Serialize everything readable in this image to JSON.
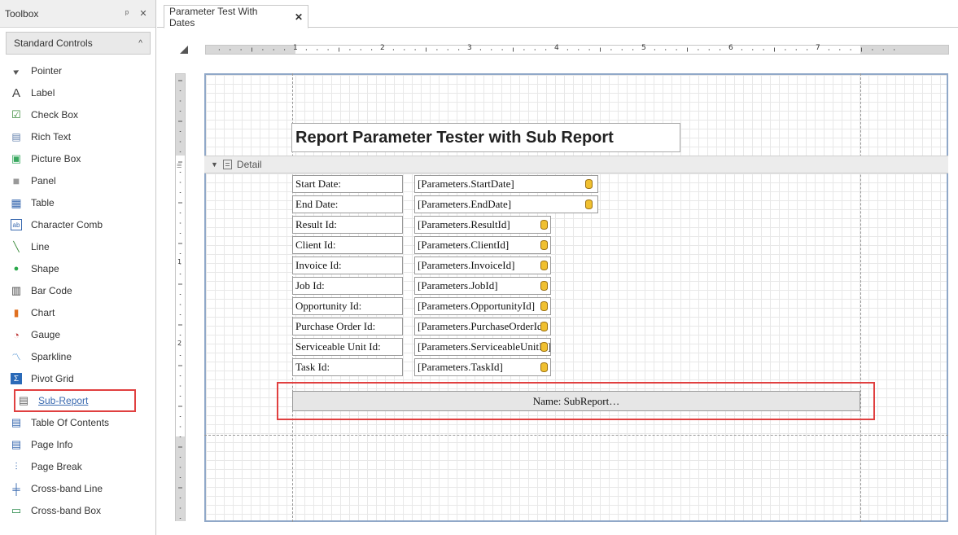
{
  "toolbox": {
    "title": "Toolbox",
    "pin_glyph": "ᵖ",
    "close_glyph": "✕",
    "group": {
      "title": "Standard Controls",
      "chevron": "^"
    },
    "items": [
      {
        "label": "Pointer",
        "icon": "pointer-icon"
      },
      {
        "label": "Label",
        "icon": "label-icon"
      },
      {
        "label": "Check Box",
        "icon": "check-box-icon"
      },
      {
        "label": "Rich Text",
        "icon": "rich-text-icon"
      },
      {
        "label": "Picture Box",
        "icon": "picture-box-icon"
      },
      {
        "label": "Panel",
        "icon": "panel-icon"
      },
      {
        "label": "Table",
        "icon": "table-icon"
      },
      {
        "label": "Character Comb",
        "icon": "character-comb-icon"
      },
      {
        "label": "Line",
        "icon": "line-icon"
      },
      {
        "label": "Shape",
        "icon": "shape-icon"
      },
      {
        "label": "Bar Code",
        "icon": "bar-code-icon"
      },
      {
        "label": "Chart",
        "icon": "chart-icon"
      },
      {
        "label": "Gauge",
        "icon": "gauge-icon"
      },
      {
        "label": "Sparkline",
        "icon": "sparkline-icon"
      },
      {
        "label": "Pivot Grid",
        "icon": "pivot-grid-icon"
      },
      {
        "label": "Sub-Report",
        "icon": "sub-report-icon"
      },
      {
        "label": "Table Of Contents",
        "icon": "table-of-contents-icon"
      },
      {
        "label": "Page Info",
        "icon": "page-info-icon"
      },
      {
        "label": "Page Break",
        "icon": "page-break-icon"
      },
      {
        "label": "Cross-band Line",
        "icon": "cross-band-line-icon"
      },
      {
        "label": "Cross-band Box",
        "icon": "cross-band-box-icon"
      }
    ]
  },
  "document": {
    "tab_label": "Parameter Test With Dates",
    "tab_close": "✕",
    "ruler_numbers": [
      "1",
      "2",
      "3",
      "4",
      "5",
      "6",
      "7"
    ],
    "vruler_numbers": [
      "1",
      "2"
    ],
    "report_title": "Report Parameter Tester with Sub Report",
    "detail_band_label": "Detail",
    "rows": [
      {
        "label": "Start Date:",
        "param": "[Parameters.StartDate]"
      },
      {
        "label": "End Date:",
        "param": "[Parameters.EndDate]"
      },
      {
        "label": "Result Id:",
        "param": "[Parameters.ResultId]"
      },
      {
        "label": "Client Id:",
        "param": "[Parameters.ClientId]"
      },
      {
        "label": "Invoice Id:",
        "param": "[Parameters.InvoiceId]"
      },
      {
        "label": "Job Id:",
        "param": "[Parameters.JobId]"
      },
      {
        "label": "Opportunity Id:",
        "param": "[Parameters.OpportunityId]"
      },
      {
        "label": "Purchase Order Id:",
        "param": "[Parameters.PurchaseOrderId]"
      },
      {
        "label": "Serviceable Unit Id:",
        "param": "[Parameters.ServiceableUnitId]"
      },
      {
        "label": "Task Id:",
        "param": "[Parameters.TaskId]"
      }
    ],
    "subreport_label": "Name: SubReport…"
  },
  "colors": {
    "highlight": "#e04040",
    "surface_border": "#90a8c8",
    "db_icon": "#f0c030"
  }
}
